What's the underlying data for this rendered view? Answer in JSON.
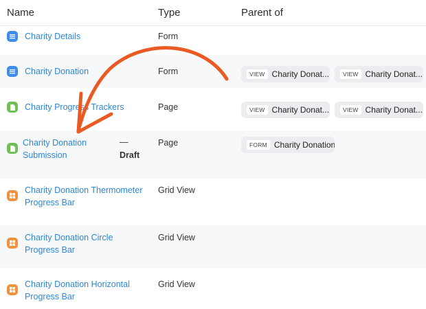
{
  "columns": {
    "name": "Name",
    "type": "Type",
    "parent_of": "Parent of"
  },
  "rows": [
    {
      "icon": "form-icon",
      "name_line1": "Charity Details",
      "name_line2": "",
      "type": "Form",
      "draft_dash": "",
      "draft": "",
      "chips": []
    },
    {
      "icon": "form-icon",
      "name_line1": "Charity Donation",
      "name_line2": "",
      "type": "Form",
      "draft_dash": "",
      "draft": "",
      "chips": [
        {
          "kind": "VIEW",
          "label": "Charity Donat..."
        },
        {
          "kind": "VIEW",
          "label": "Charity Donat..."
        }
      ]
    },
    {
      "icon": "page-icon",
      "name_line1": "Charity Progress Trackers",
      "name_line2": "",
      "type": "Page",
      "draft_dash": "",
      "draft": "",
      "chips": [
        {
          "kind": "VIEW",
          "label": "Charity Donat..."
        },
        {
          "kind": "VIEW",
          "label": "Charity Donat..."
        }
      ]
    },
    {
      "icon": "page-icon",
      "name_line1": "Charity Donation",
      "name_line2": "Submission",
      "type": "Page",
      "draft_dash": "—",
      "draft": "Draft",
      "chips": [
        {
          "kind": "FORM",
          "label": "Charity Donation"
        }
      ]
    },
    {
      "icon": "grid-icon",
      "name_line1": "Charity Donation Thermometer",
      "name_line2": "Progress Bar",
      "type": "Grid View",
      "draft_dash": "",
      "draft": "",
      "chips": []
    },
    {
      "icon": "grid-icon",
      "name_line1": "Charity Donation Circle",
      "name_line2": "Progress Bar",
      "type": "Grid View",
      "draft_dash": "",
      "draft": "",
      "chips": []
    },
    {
      "icon": "grid-icon",
      "name_line1": "Charity Donation Horizontal",
      "name_line2": "Progress Bar",
      "type": "Grid View",
      "draft_dash": "",
      "draft": "",
      "chips": []
    }
  ],
  "colors": {
    "link": "#2e86d6",
    "form": "#3d8de9",
    "page": "#6fbf55",
    "grid": "#f0923c",
    "annotation_arrow": "#ea5a24"
  }
}
